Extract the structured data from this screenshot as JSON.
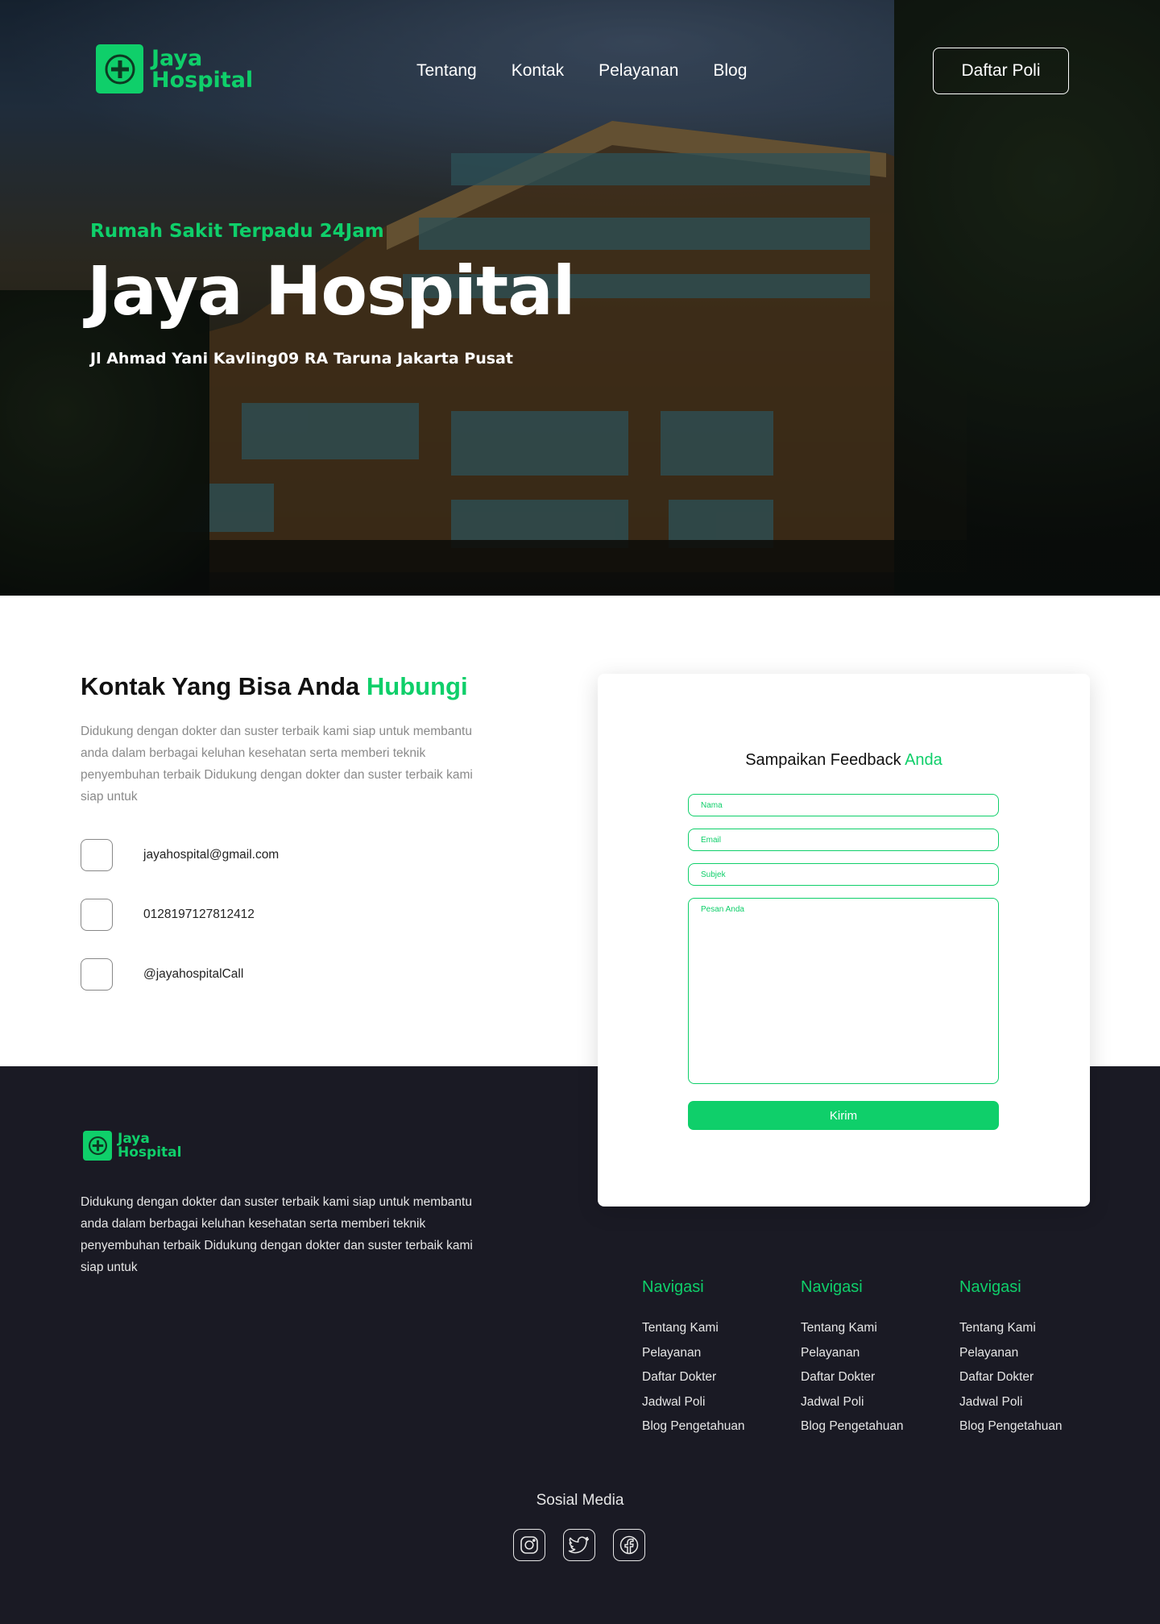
{
  "brand": {
    "line1": "Jaya",
    "line2": "Hospital",
    "accent": "#0fcf6a",
    "icon": "plus-circle-icon"
  },
  "nav": {
    "items": [
      "Tentang",
      "Kontak",
      "Pelayanan",
      "Blog"
    ],
    "cta": "Daftar Poli"
  },
  "hero": {
    "subtitle": "Rumah Sakit Terpadu 24Jam",
    "title": "Jaya Hospital",
    "address": "Jl Ahmad Yani Kavling09 RA Taruna Jakarta Pusat"
  },
  "contact": {
    "title_main": "Kontak Yang Bisa Anda ",
    "title_accent": "Hubungi",
    "description": "Didukung dengan dokter dan suster terbaik kami siap untuk membantu anda dalam berbagai keluhan kesehatan serta memberi teknik penyembuhan terbaik Didukung dengan dokter dan suster terbaik kami siap untuk",
    "items": [
      {
        "value": "jayahospital@gmail.com"
      },
      {
        "value": "0128197127812412"
      },
      {
        "value": "@jayahospitalCall"
      }
    ]
  },
  "form": {
    "title_main": "Sampaikan Feedback ",
    "title_accent": "Anda",
    "name_placeholder": "Nama",
    "email_placeholder": "Email",
    "subject_placeholder": "Subjek",
    "message_placeholder": "Pesan Anda",
    "submit": "Kirim"
  },
  "footer": {
    "description": "Didukung dengan dokter dan suster terbaik kami siap untuk membantu anda dalam berbagai keluhan kesehatan serta memberi teknik penyembuhan terbaik Didukung dengan dokter dan suster terbaik kami siap untuk",
    "columns": [
      {
        "title": "Navigasi",
        "links": [
          "Tentang Kami",
          "Pelayanan",
          "Daftar Dokter",
          "Jadwal Poli",
          "Blog Pengetahuan"
        ]
      },
      {
        "title": "Navigasi",
        "links": [
          "Tentang Kami",
          "Pelayanan",
          "Daftar Dokter",
          "Jadwal Poli",
          "Blog Pengetahuan"
        ]
      },
      {
        "title": "Navigasi",
        "links": [
          "Tentang Kami",
          "Pelayanan",
          "Daftar Dokter",
          "Jadwal Poli",
          "Blog Pengetahuan"
        ]
      }
    ],
    "social_title": "Sosial Media",
    "social": [
      "instagram-icon",
      "twitter-icon",
      "facebook-icon"
    ],
    "background": "#1a1a24"
  }
}
